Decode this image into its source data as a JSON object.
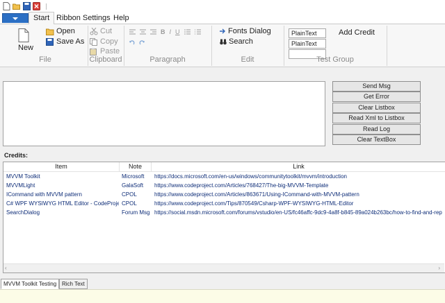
{
  "ribbon": {
    "tabs": [
      {
        "label": "Start",
        "active": true
      },
      {
        "label": "Ribbon Settings"
      },
      {
        "label": "Help"
      }
    ],
    "groups": {
      "file": {
        "label": "File",
        "new": "New",
        "open": "Open",
        "save_as": "Save As"
      },
      "clipboard": {
        "label": "Clipboard",
        "cut": "Cut",
        "copy": "Copy",
        "paste": "Paste"
      },
      "paragraph": {
        "label": "Paragraph",
        "bold": "B",
        "italic": "I",
        "underline": "U"
      },
      "edit": {
        "label": "Edit",
        "fonts_dialog": "Fonts Dialog",
        "search": "Search"
      },
      "test": {
        "label": "Test Group",
        "text1": "PlainText",
        "text2": "PlainText",
        "text3": "",
        "add_credit": "Add Credit"
      }
    }
  },
  "buttons": [
    "Send Msg",
    "Get Error",
    "Clear Listbox",
    "Read Xml to Listbox",
    "Read Log",
    "Clear TextBox"
  ],
  "credits": {
    "label": "Credits:",
    "columns": [
      "Item",
      "Note",
      "Link"
    ],
    "rows": [
      {
        "item": "MVVM Toolkit",
        "note": "Microsoft",
        "link": "https://docs.microsoft.com/en-us/windows/communitytoolkit/mvvm/introduction"
      },
      {
        "item": "MVVMLight",
        "note": "GalaSoft",
        "link": "https://www.codeproject.com/Articles/768427/The-big-MVVM-Template"
      },
      {
        "item": "ICommand with MVVM pattern",
        "note": "CPOL",
        "link": "https://www.codeproject.com/Articles/863671/Using-ICommand-with-MVVM-pattern"
      },
      {
        "item": "C# WPF WYSIWYG HTML Editor - CodeProject",
        "note": "CPOL",
        "link": "https://www.codeproject.com/Tips/870549/Csharp-WPF-WYSIWYG-HTML-Editor"
      },
      {
        "item": "SearchDialog",
        "note": "Forum Msg",
        "link": "https://social.msdn.microsoft.com/forums/vstudio/en-US/fc46affc-9dc9-4a8f-b845-89a024b263bc/how-to-find-and-rep"
      }
    ]
  },
  "bottom_tabs": [
    {
      "label": "MVVM Toolkit Testing",
      "active": true
    },
    {
      "label": "Rich Text"
    }
  ],
  "colors": {
    "accent": "#2b6fc4",
    "link_text": "#0e2d78",
    "status_bar": "#fcfce7"
  }
}
